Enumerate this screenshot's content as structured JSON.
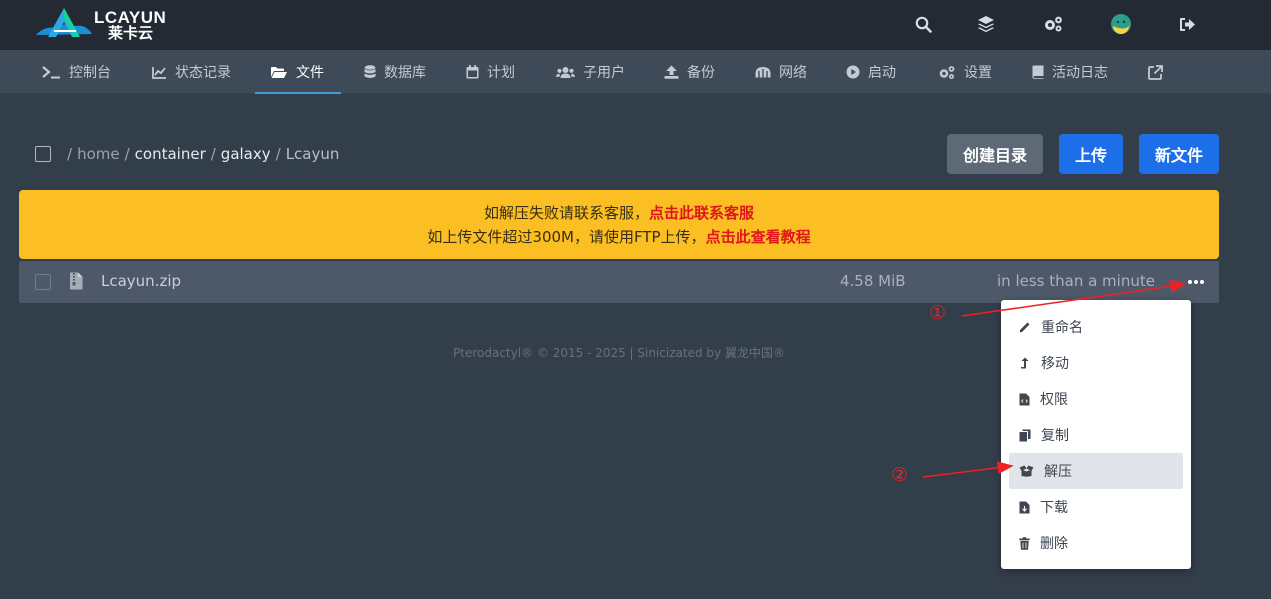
{
  "header": {
    "logo_en": "LCAYUN",
    "logo_zh": "莱卡云",
    "icons": [
      "search-icon",
      "layers-icon",
      "cogs-icon",
      "avatar",
      "logout-icon"
    ]
  },
  "nav": {
    "items": [
      {
        "label": "控制台",
        "icon": "terminal-icon"
      },
      {
        "label": "状态记录",
        "icon": "chart-line-icon"
      },
      {
        "label": "文件",
        "icon": "folder-open-icon",
        "active": true
      },
      {
        "label": "数据库",
        "icon": "database-icon"
      },
      {
        "label": "计划",
        "icon": "calendar-icon"
      },
      {
        "label": "子用户",
        "icon": "users-icon"
      },
      {
        "label": "备份",
        "icon": "upload-icon"
      },
      {
        "label": "网络",
        "icon": "network-icon"
      },
      {
        "label": "启动",
        "icon": "play-circle-icon"
      },
      {
        "label": "设置",
        "icon": "cogs-icon"
      },
      {
        "label": "活动日志",
        "icon": "book-icon"
      }
    ],
    "external_icon": "external-link-icon"
  },
  "breadcrumb": {
    "segments": [
      "home",
      "container",
      "galaxy",
      "Lcayun"
    ],
    "separator": "/"
  },
  "actions": {
    "create_dir": "创建目录",
    "upload": "上传",
    "new_file": "新文件"
  },
  "notice": {
    "line1_text": "如解压失败请联系客服，",
    "line1_link": "点击此联系客服",
    "line2_text": "如上传文件超过300M，请使用FTP上传，",
    "line2_link": "点击此查看教程"
  },
  "file": {
    "name": "Lcayun.zip",
    "size": "4.58 MiB",
    "modified": "in less than a minute"
  },
  "footer": "Pterodactyl® © 2015 - 2025 | Sinicizated by 翼龙中国®",
  "context_menu": {
    "items": [
      {
        "label": "重命名",
        "icon": "pencil-icon"
      },
      {
        "label": "移动",
        "icon": "move-arrow-icon"
      },
      {
        "label": "权限",
        "icon": "file-code-icon"
      },
      {
        "label": "复制",
        "icon": "copy-icon"
      },
      {
        "label": "解压",
        "icon": "box-open-icon",
        "highlighted": true
      },
      {
        "label": "下载",
        "icon": "file-download-icon"
      },
      {
        "label": "删除",
        "icon": "trash-icon"
      }
    ]
  },
  "annotations": {
    "step1": "①",
    "step2": "②",
    "color": "#ee2222"
  },
  "colors": {
    "topbar": "#232a33",
    "navbar": "#3e4a58",
    "background": "#333e4b",
    "accent_blue": "#1c6fe8",
    "notice_yellow": "#fbbf24",
    "notice_link": "#e0161a"
  }
}
